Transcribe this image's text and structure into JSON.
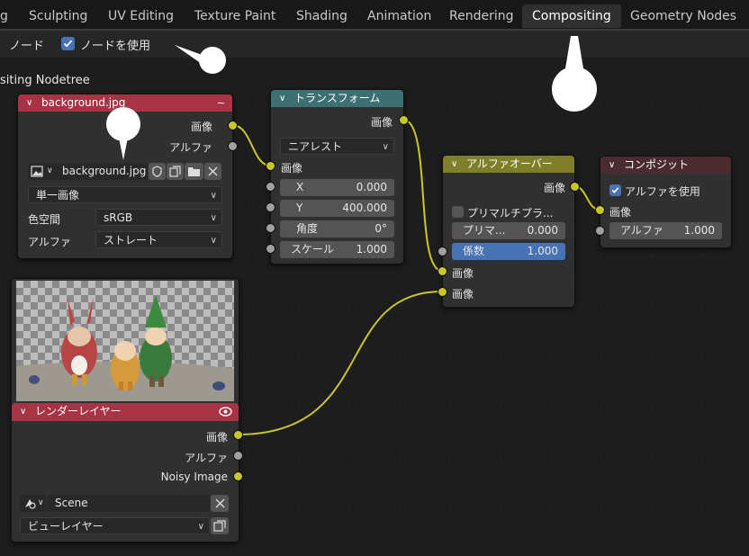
{
  "workspace_tabs": [
    "g",
    "Sculpting",
    "UV Editing",
    "Texture Paint",
    "Shading",
    "Animation",
    "Rendering",
    "Compositing",
    "Geometry Nodes"
  ],
  "active_tab": "Compositing",
  "header": {
    "node_menu": "ノード",
    "use_nodes_label": "ノードを使用",
    "use_nodes_checked": true,
    "tree_title": "siting Nodetree"
  },
  "nodes": {
    "image": {
      "title": "background.jpg",
      "header_color": "#a73344",
      "out_image": "画像",
      "out_alpha": "アルファ",
      "image_name": "background.jpg",
      "source": "単一画像",
      "colorspace_label": "色空間",
      "colorspace_value": "sRGB",
      "alpha_label": "アルファ",
      "alpha_value": "ストレート"
    },
    "transform": {
      "title": "トランスフォーム",
      "header_color": "#3c7072",
      "out_image": "画像",
      "filter": "ニアレスト",
      "in_image": "画像",
      "x_label": "X",
      "x_value": "0.000",
      "y_label": "Y",
      "y_value": "400.000",
      "angle_label": "角度",
      "angle_value": "0°",
      "scale_label": "スケール",
      "scale_value": "1.000"
    },
    "alpha_over": {
      "title": "アルファオーバー",
      "header_color": "#7f7f2a",
      "out_image": "画像",
      "premult_check_label": "プリマルチプラ...",
      "premult_label": "プリマ...",
      "premult_value": "0.000",
      "factor_label": "係数",
      "factor_value": "1.000",
      "in_image1": "画像",
      "in_image2": "画像"
    },
    "composite": {
      "title": "コンポジット",
      "header_color": "#4a2b30",
      "use_alpha_label": "アルファを使用",
      "use_alpha_checked": true,
      "in_image": "画像",
      "alpha_label": "アルファ",
      "alpha_value": "1.000"
    },
    "render_layers": {
      "title": "レンダーレイヤー",
      "header_color": "#a73344",
      "out_image": "画像",
      "out_alpha": "アルファ",
      "out_noisy": "Noisy Image",
      "scene": "Scene",
      "view_layer": "ビューレイヤー"
    }
  },
  "colors": {
    "socket_image": "#c7c729",
    "socket_value": "#a1a1a1",
    "link": "#c7c729",
    "accent": "#4772b3"
  }
}
